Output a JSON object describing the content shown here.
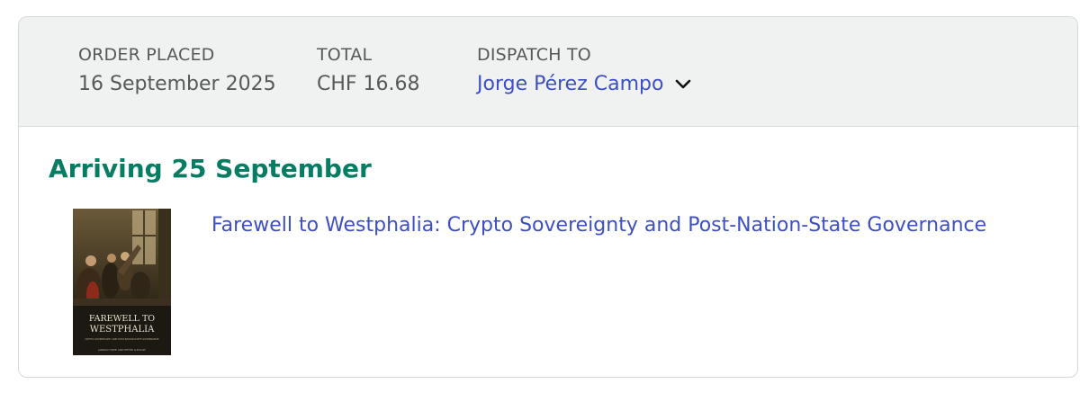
{
  "order": {
    "placed_label": "ORDER PLACED",
    "placed_value": "16 September 2025",
    "total_label": "TOTAL",
    "total_value": "CHF 16.68",
    "dispatch_label": "DISPATCH TO",
    "dispatch_value": "Jorge Pérez Campo",
    "dispatch_icon": "chevron-down-icon"
  },
  "shipment": {
    "arrival_text": "Arriving 25 September"
  },
  "product": {
    "title": "Farewell to Westphalia: Crypto Sovereignty and Post-Nation-State Governance",
    "cover": {
      "title_line1": "FAREWELL TO",
      "title_line2": "WESTPHALIA",
      "subtitle": "CRYPTO SOVEREIGNTY AND POST-NATION-STATE GOVERNANCE",
      "authors": "JARRAD HOPE AND PETER LUDLOW"
    }
  },
  "colors": {
    "header_bg": "#f0f2f2",
    "link": "#3d4fc4",
    "arrival": "#067d62",
    "muted_text": "#565959",
    "border": "#d5d9d9"
  }
}
